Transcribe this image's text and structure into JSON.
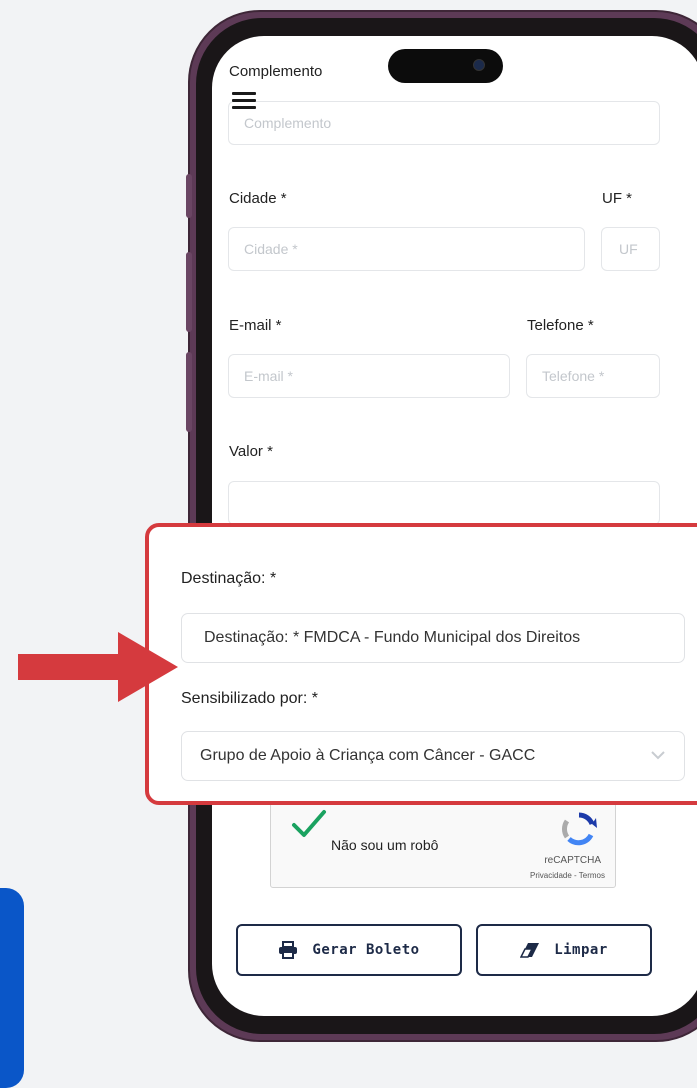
{
  "form": {
    "complemento": {
      "label": "Complemento",
      "placeholder": "Complemento"
    },
    "cidade": {
      "label": "Cidade *",
      "placeholder": "Cidade *"
    },
    "uf": {
      "label": "UF *",
      "placeholder": "UF"
    },
    "email": {
      "label": "E-mail *",
      "placeholder": "E-mail *"
    },
    "telefone": {
      "label": "Telefone *",
      "placeholder": "Telefone *"
    },
    "valor": {
      "label": "Valor *",
      "placeholder": ""
    }
  },
  "highlight": {
    "destinacao": {
      "label": "Destinação: *",
      "value": "Destinação: * FMDCA - Fundo Municipal dos Direitos"
    },
    "sensibilizado": {
      "label": "Sensibilizado por: *",
      "value": "Grupo de Apoio à Criança com Câncer - GACC"
    }
  },
  "captcha": {
    "label": "Não sou um robô",
    "brand": "reCAPTCHA",
    "terms": "Privacidade - Termos"
  },
  "buttons": {
    "generate": "Gerar Boleto",
    "clear": "Limpar"
  },
  "colors": {
    "highlight_border": "#d53a3e",
    "button_border": "#1d2a47",
    "accent_blue": "#0a56c8",
    "phone_frame": "#5d3a56"
  }
}
